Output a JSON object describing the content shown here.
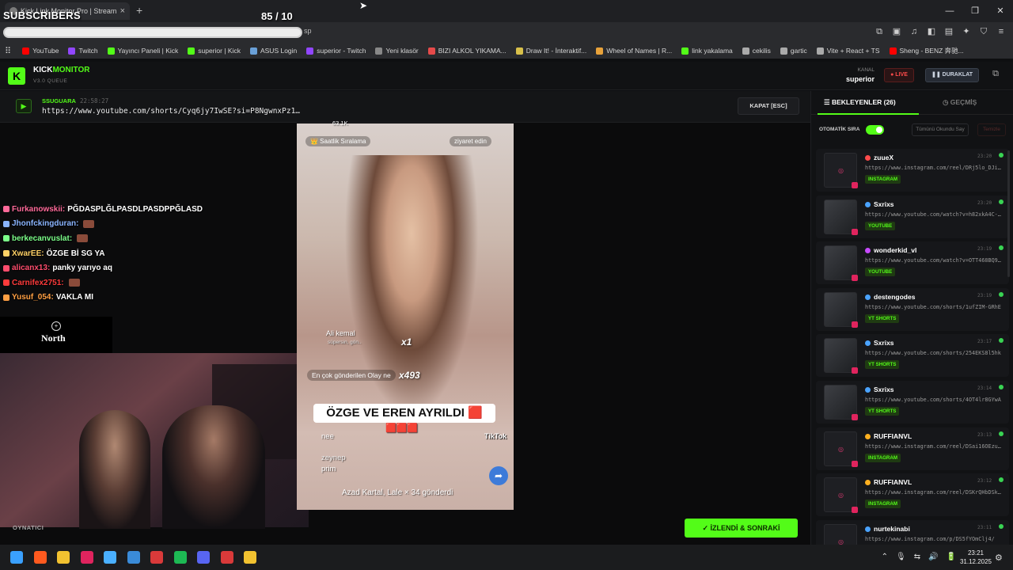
{
  "browser": {
    "tab_title": "Kick Link Monitor Pro | Stream",
    "tab_close": "×",
    "new_tab": "+",
    "omni_tail": "sp",
    "window_controls": [
      "—",
      "❐",
      "✕"
    ],
    "bookmarks": [
      {
        "label": "YouTube",
        "color": "#ff0000"
      },
      {
        "label": "Twitch",
        "color": "#9146ff"
      },
      {
        "label": "Yayıncı Paneli | Kick",
        "color": "#53fc18"
      },
      {
        "label": "superior | Kick",
        "color": "#53fc18"
      },
      {
        "label": "ASUS Login",
        "color": "#6aa0d8"
      },
      {
        "label": "superior - Twitch",
        "color": "#9146ff"
      },
      {
        "label": "Yeni klasör",
        "color": "#888888"
      },
      {
        "label": "BIZI ALKOL YIKAMA...",
        "color": "#e64a4a"
      },
      {
        "label": "Draw It! - İnteraktif...",
        "color": "#d8c04a"
      },
      {
        "label": "Wheel of Names | R...",
        "color": "#e8a23a"
      },
      {
        "label": "link yakalama",
        "color": "#53fc18"
      },
      {
        "label": "cekilis",
        "color": "#aaaaaa"
      },
      {
        "label": "gartic",
        "color": "#aaaaaa"
      },
      {
        "label": "Vite + React + TS",
        "color": "#aaaaaa"
      },
      {
        "label": "Sheng - BENZ 奔驰...",
        "color": "#ff0000"
      }
    ]
  },
  "overlay": {
    "subscribers_label": "SUBSCRIBERS",
    "subscribers_count": "85  / 10"
  },
  "app": {
    "logo_letter": "K",
    "brand_prefix": "KICK",
    "brand_suffix": "MONITOR",
    "version": "V3.0 QUEUE",
    "kanal_label": "KANAL",
    "kanal_value": "superior",
    "live_label": "● LIVE",
    "pause_label": "❚❚ DURAKLAT",
    "current": {
      "user": "SSUGUARA",
      "time": "22:58:27",
      "url": "https://www.youtube.com/shorts/Cyq6jy7IwSE?si=P8NgwnxPz1…"
    },
    "close_label": "KAPAT [ESC]",
    "next_label": "✓  İZLENDİ & SONRAKİ",
    "playing_label": "OYNATICI",
    "colors": {
      "accent": "#53fc18",
      "live": "#ff4b4b"
    }
  },
  "chat": [
    {
      "user": "Furkanowskii:",
      "text": "PĞDASPLĞLPASDLPASDPPĞLASD",
      "color": "#ff6a9a",
      "emote": false
    },
    {
      "user": "Jhonfckingduran:",
      "text": "",
      "color": "#8ab4ff",
      "emote": true
    },
    {
      "user": "berkecanvuslat:",
      "text": "",
      "color": "#7cff8a",
      "emote": true
    },
    {
      "user": "XwarEE:",
      "text": "ÖZGE Bİ SG YA",
      "color": "#ffd166",
      "emote": false
    },
    {
      "user": "alicanx13:",
      "text": "panky yarıyo aq",
      "color": "#ff4d6d",
      "emote": false
    },
    {
      "user": "Carnifex2751:",
      "text": "",
      "color": "#ff3b3b",
      "emote": true
    },
    {
      "user": "Yusuf_054:",
      "text": "VAKLA MI",
      "color": "#ff9f43",
      "emote": false
    }
  ],
  "north": {
    "text": "North"
  },
  "video": {
    "tag_left": "👑 Saatlik Sıralama",
    "tag_right": "ziyaret edin",
    "viewer_count": "63.1K",
    "comment_user": "Ali kemal",
    "comment_sub": "süpersin, gön..",
    "x1": "x1",
    "gift_label": "En çok gönderilen Olay ne",
    "x493": "x493",
    "banner": "ÖZGE VE EREN AYRILDI 🟥",
    "banner_emojis": "🟥🟥🟥",
    "c1": "nee",
    "c2_user": "zeynep",
    "c2_text": "prim",
    "footer": "Azad Kartal, Lale  × 34 gönderdi",
    "tiktok": "TikTok"
  },
  "side": {
    "tab_active": "☰  BEKLEYENLER (26)",
    "tab_inactive": "◷  GEÇMİŞ",
    "auto_label": "OTOMATİK SIRA",
    "mark_all": "Tümünü Okundu Say",
    "clear": "Temizle",
    "queue": [
      {
        "user": "zuueX",
        "time": "23:20",
        "url": "https://www.instagram.com/reel/DRj5lo_DJi…",
        "tag": "INSTAGRAM",
        "platcolor": "#ff4b4b",
        "thumb": false
      },
      {
        "user": "Sxrixs",
        "time": "23:20",
        "url": "https://www.youtube.com/watch?v=h82xkA4C-…",
        "tag": "YOUTUBE",
        "platcolor": "#4aa3ff",
        "thumb": true
      },
      {
        "user": "wonderkid_vl",
        "time": "23:19",
        "url": "https://www.youtube.com/watch?v=OTT468BQ9…",
        "tag": "YOUTUBE",
        "platcolor": "#c74aff",
        "thumb": true
      },
      {
        "user": "destengodes",
        "time": "23:19",
        "url": "https://www.youtube.com/shorts/1ufZIM-GRhE",
        "tag": "YT SHORTS",
        "platcolor": "#4aa3ff",
        "thumb": true
      },
      {
        "user": "Sxrixs",
        "time": "23:17",
        "url": "https://www.youtube.com/shorts/254EKS8l5hk",
        "tag": "YT SHORTS",
        "platcolor": "#4aa3ff",
        "thumb": true
      },
      {
        "user": "Sxrixs",
        "time": "23:14",
        "url": "https://www.youtube.com/shorts/4OT4lr8GYwA",
        "tag": "YT SHORTS",
        "platcolor": "#4aa3ff",
        "thumb": true
      },
      {
        "user": "RUFFIANVL",
        "time": "23:13",
        "url": "https://www.instagram.com/reel/DSai16OEzu…",
        "tag": "INSTAGRAM",
        "platcolor": "#ffb020",
        "thumb": false
      },
      {
        "user": "RUFFIANVL",
        "time": "23:12",
        "url": "https://www.instagram.com/reel/DSKrQHbDSk…",
        "tag": "INSTAGRAM",
        "platcolor": "#ffb020",
        "thumb": false
      },
      {
        "user": "nurtekinabi",
        "time": "23:11",
        "url": "https://www.instagram.com/p/DS5fYOmClj4/",
        "tag": "",
        "platcolor": "#4aa3ff",
        "thumb": false
      }
    ]
  },
  "taskbar": {
    "time": "23:21",
    "date": "31.12.2025",
    "tray": [
      "⌃",
      "🎙",
      "⇆",
      "🔊",
      "🔋"
    ],
    "icons": [
      "windows-start",
      "brave",
      "files",
      "maps",
      "steam",
      "edge",
      "teamspeak",
      "spotify",
      "discord",
      "anydesk",
      "chrome"
    ],
    "icon_colors": [
      "#3aa0ff",
      "#ff5a1f",
      "#f2c230",
      "#e0245e",
      "#4ab0ff",
      "#3a8bd8",
      "#d93a3a",
      "#1db954",
      "#5865f2",
      "#d93a3a",
      "#f2c230"
    ]
  }
}
